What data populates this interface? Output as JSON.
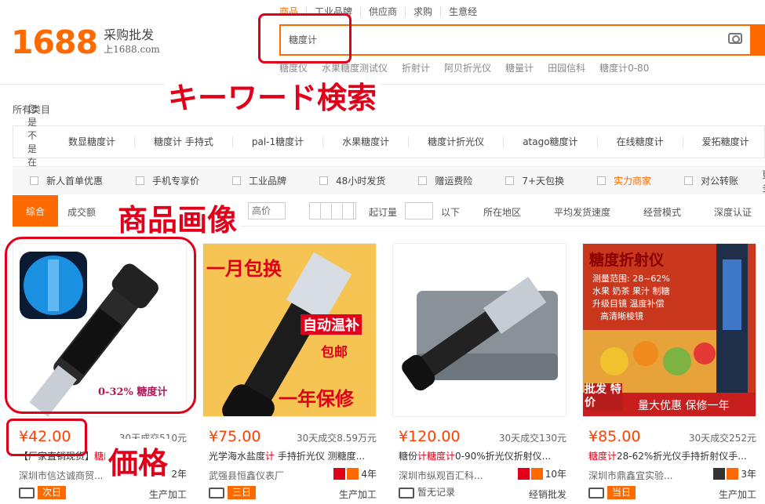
{
  "logo": {
    "number": "1688",
    "line1": "采购批发",
    "line2": "上1688.com"
  },
  "topnav": [
    "商品",
    "工业品牌",
    "供应商",
    "求购",
    "生意经"
  ],
  "search": {
    "value": "糖度计"
  },
  "hot_searches": [
    "糖度仪",
    "水果糖度测试仪",
    "折射计",
    "阿贝折光仪",
    "糖量计",
    "田园信科",
    "糖度计0-80"
  ],
  "annotations": {
    "keyword": "キーワード検索",
    "image": "商品画像",
    "price": "価格"
  },
  "all_categories": "所有类目",
  "suggest": {
    "label": "您是不是在找:",
    "items": [
      "数显糖度计",
      "糖度计 手持式",
      "pal-1糖度计",
      "水果糖度计",
      "糖度计折光仪",
      "atago糖度计",
      "在线糖度计",
      "爱拓糖度计"
    ]
  },
  "filters": [
    "新人首单优惠",
    "手机专享价",
    "工业品牌",
    "48小时发货",
    "赠运费险",
    "7+天包换",
    "实力商家",
    "对公转账"
  ],
  "filters_more": "更多",
  "sortbar": {
    "active": "综合",
    "volume": "成交额",
    "price_high_placeholder": "高价",
    "start_qty": "起订量",
    "below": "以下",
    "region": "所在地区",
    "ship_speed": "平均发货速度",
    "biz_mode": "经营模式",
    "depth_cert": "深度认证"
  },
  "products": [
    {
      "price": "¥42.00",
      "sold": "30天成交510元",
      "title_pre": "【厂家直销现货】",
      "title_hl": "糖度计",
      "title_post": "",
      "shop": "深圳市信达诚商贸...",
      "years": "2年",
      "ship": "次日",
      "process": "生产加工",
      "image_text": "0-32% 糖度计"
    },
    {
      "price": "¥75.00",
      "sold": "30天成交8.59万元",
      "title_pre": "光学海水盐度",
      "title_hl": "计",
      "title_post": " 手持折光仪 测糖度...",
      "shop": "武强县恒鑫仪表厂",
      "years": "4年",
      "ship": "三日",
      "process": "生产加工",
      "image_text": "一月包换",
      "image_text2": "自动温补",
      "image_text3": "包邮",
      "image_text4": "一年保修"
    },
    {
      "price": "¥120.00",
      "sold": "30天成交130元",
      "title_pre": "糖份",
      "title_hl": "计糖度计",
      "title_post": "0-90%折光仪折射仪...",
      "shop": "深圳市纵观百汇科...",
      "years": "10年",
      "ship": "暂无记录",
      "process": "经销批发"
    },
    {
      "price": "¥85.00",
      "sold": "30天成交252元",
      "title_pre": "",
      "title_hl": "糖度计",
      "title_post": "28-62%折光仪手持折射仪手...",
      "shop": "深圳市鼎鑫宜实验...",
      "years": "3年",
      "ship": "当日",
      "process": "生产加工",
      "image_title": "糖度折射仪",
      "image_range": "测量范围: 28~62%",
      "image_l1": "水果 奶茶 果汁 制糖",
      "image_l2": "升级目镜 温度补偿",
      "image_l3": "高清晰棱镜",
      "image_badge": "批发 特价",
      "image_footer": "量大优惠 保修一年"
    }
  ],
  "colors": {
    "accent": "#ff6a00",
    "annotation": "#e0001a"
  }
}
